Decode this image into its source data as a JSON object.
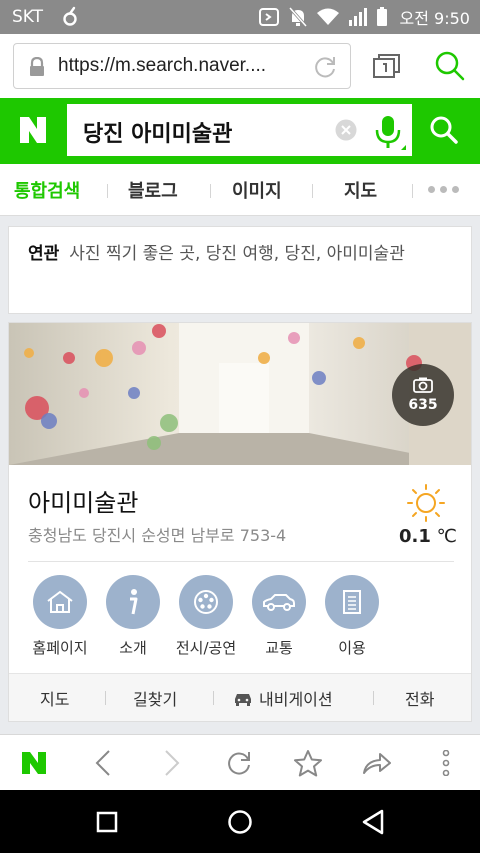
{
  "status_bar": {
    "carrier": "SKT",
    "time": "오전 9:50",
    "icons": [
      "key-icon",
      "nfc-icon",
      "mute-icon",
      "wifi-icon",
      "signal-icon",
      "battery-icon"
    ]
  },
  "browser": {
    "url": "https://m.search.naver....",
    "icons": [
      "lock-icon",
      "reload-icon",
      "tabs-icon",
      "search-icon"
    ]
  },
  "search": {
    "logo": "N",
    "query": "당진 아미미술관"
  },
  "tabs": [
    {
      "label": "통합검색",
      "active": true
    },
    {
      "label": "블로그",
      "active": false
    },
    {
      "label": "이미지",
      "active": false
    },
    {
      "label": "지도",
      "active": false
    }
  ],
  "related": {
    "label": "연관",
    "text": "사진 찍기 좋은 곳, 당진 여행, 당진, 아미미술관"
  },
  "place": {
    "photo_count": "635",
    "name": "아미미술관",
    "address": "충청남도 당진시 순성면 남부로 753-4",
    "temperature": "0.1",
    "temperature_unit": "℃",
    "weather": "sunny",
    "shortcuts": [
      {
        "label": "홈페이지",
        "icon": "home-icon"
      },
      {
        "label": "소개",
        "icon": "info-icon"
      },
      {
        "label": "전시/공연",
        "icon": "film-reel-icon"
      },
      {
        "label": "교통",
        "icon": "car-icon"
      },
      {
        "label": "이용",
        "icon": "document-icon"
      }
    ],
    "footer": [
      "지도",
      "길찾기",
      "내비게이션",
      "전화"
    ]
  },
  "colors": {
    "naver_green": "#1ec800",
    "shortcut_circle": "#9db2cc"
  }
}
